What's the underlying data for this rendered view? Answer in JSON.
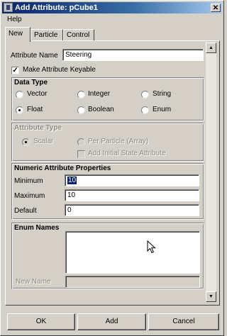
{
  "window": {
    "title": "Add Attribute: pCube1",
    "close_glyph": "✕"
  },
  "menu": {
    "help": "Help"
  },
  "tabs": [
    {
      "label": "New"
    },
    {
      "label": "Particle"
    },
    {
      "label": "Control"
    }
  ],
  "attribute_name": {
    "label": "Attribute Name",
    "value": "Steering"
  },
  "keyable": {
    "label": "Make Attribute Keyable",
    "checked": true
  },
  "data_type": {
    "title": "Data Type",
    "options": [
      "Vector",
      "Integer",
      "String",
      "Float",
      "Boolean",
      "Enum"
    ],
    "selected": "Float"
  },
  "attribute_type": {
    "title": "Attribute Type",
    "scalar": "Scalar",
    "per_particle": "Per Particle (Array)",
    "initial_state": "Add Initial State Attribute"
  },
  "numeric": {
    "title": "Numeric Attribute Properties",
    "minimum_label": "Minimum",
    "minimum": "10",
    "maximum_label": "Maximum",
    "maximum": "10",
    "default_label": "Default",
    "default": "0"
  },
  "enum": {
    "title": "Enum Names",
    "new_name_label": "New Name",
    "new_name_value": ""
  },
  "buttons": {
    "ok": "OK",
    "add": "Add",
    "cancel": "Cancel"
  },
  "scroll": {
    "up": "▲",
    "down": "▼"
  },
  "colors": {
    "titlebar": "#0a246a",
    "face": "#d4d0c8",
    "selection": "#0a246a"
  }
}
